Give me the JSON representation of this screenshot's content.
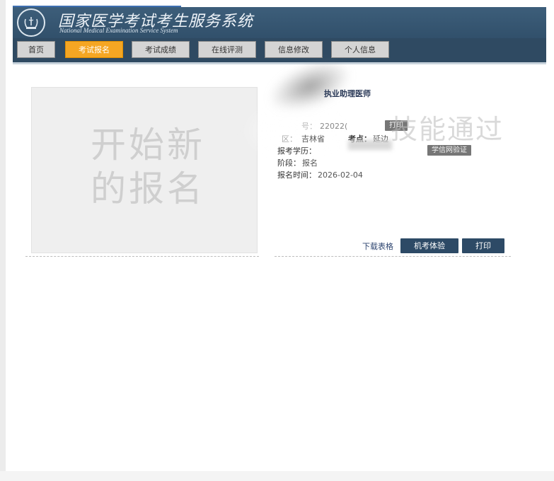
{
  "header": {
    "title": "国家医学考试考生服务系统",
    "subtitle": "National Medical Examination Service System"
  },
  "nav": [
    {
      "label": "首页",
      "active": false
    },
    {
      "label": "考试报名",
      "active": true
    },
    {
      "label": "考试成绩",
      "active": false
    },
    {
      "label": "在线评测",
      "active": false
    },
    {
      "label": "信息修改",
      "active": false
    },
    {
      "label": "个人信息",
      "active": false
    }
  ],
  "new_registration": {
    "line1": "开始新",
    "line2": "的报名"
  },
  "registration": {
    "exam_title": "执业助理医师",
    "number_label": "号：",
    "number_value": "22022(",
    "print_small": "打印",
    "status_stamp": "技能通过",
    "region_label": "区：",
    "region_value": "吉林省",
    "site_label": "考点：",
    "site_value": "延边",
    "education_label": "报考学历：",
    "verify_button": "学信网验证",
    "stage_label": "阶段：",
    "stage_value": "报名",
    "reg_time_label": "报名时间：",
    "reg_time_value": "2026-02-04"
  },
  "actions": {
    "download": "下载表格",
    "cbt": "机考体验",
    "print": "打印"
  },
  "colors": {
    "header_bg": "#34546f",
    "nav_bg": "#2f4a62",
    "nav_active": "#f5a623",
    "action_button": "#2d4a66"
  }
}
